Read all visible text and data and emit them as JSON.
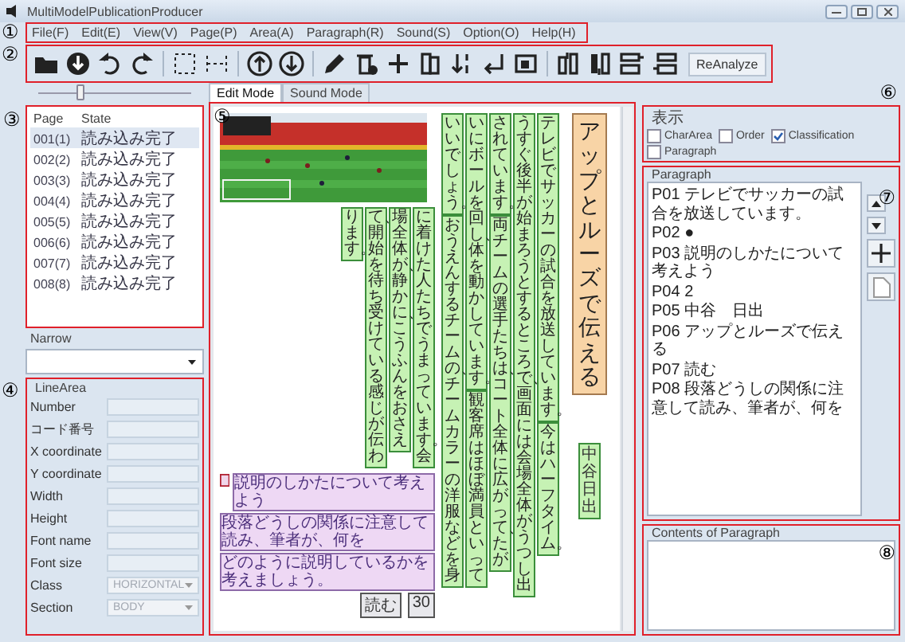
{
  "window": {
    "title": "MultiModelPublicationProducer"
  },
  "annotations": [
    "①",
    "②",
    "③",
    "④",
    "⑤",
    "⑥",
    "⑦",
    "⑧"
  ],
  "menu": [
    "File(F)",
    "Edit(E)",
    "View(V)",
    "Page(P)",
    "Area(A)",
    "Paragraph(R)",
    "Sound(S)",
    "Option(O)",
    "Help(H)"
  ],
  "toolbar": {
    "reanalyze": "ReAnalyze"
  },
  "left": {
    "page_slider": {
      "level": 0.25
    },
    "page_list": {
      "columns": [
        "Page",
        "State"
      ],
      "rows": [
        {
          "page": "001(1)",
          "state": "読み込み完了",
          "selected": true
        },
        {
          "page": "002(2)",
          "state": "読み込み完了",
          "selected": false
        },
        {
          "page": "003(3)",
          "state": "読み込み完了",
          "selected": false
        },
        {
          "page": "004(4)",
          "state": "読み込み完了",
          "selected": false
        },
        {
          "page": "005(5)",
          "state": "読み込み完了",
          "selected": false
        },
        {
          "page": "006(6)",
          "state": "読み込み完了",
          "selected": false
        },
        {
          "page": "007(7)",
          "state": "読み込み完了",
          "selected": false
        },
        {
          "page": "008(8)",
          "state": "読み込み完了",
          "selected": false
        }
      ]
    },
    "narrow": {
      "label": "Narrow"
    },
    "line_area": {
      "title": "LineArea",
      "fields": [
        {
          "label": "Number",
          "kind": "text"
        },
        {
          "label": "コード番号",
          "kind": "text"
        },
        {
          "label": "X coordinate",
          "kind": "text"
        },
        {
          "label": "Y coordinate",
          "kind": "text"
        },
        {
          "label": "Width",
          "kind": "text"
        },
        {
          "label": "Height",
          "kind": "text"
        },
        {
          "label": "Font name",
          "kind": "text"
        },
        {
          "label": "Font size",
          "kind": "text"
        },
        {
          "label": "Class",
          "kind": "select",
          "value": "HORIZONTAL",
          "disabled": true
        },
        {
          "label": "Section",
          "kind": "select",
          "value": "BODY",
          "disabled": true
        }
      ]
    }
  },
  "tabs": [
    {
      "label": "Edit Mode",
      "selected": true
    },
    {
      "label": "Sound Mode",
      "selected": false
    }
  ],
  "document": {
    "title": "アップとルーズで伝える",
    "author": "中谷日出",
    "top_columns": [
      {
        "segments": [
          "いいでしょう。",
          "おうえんするチームの、チームカラーの洋服などを身"
        ]
      },
      {
        "segments": [
          "いにボールを回し、体を動かしています。",
          "観客席はほぼ満員といって"
        ]
      },
      {
        "segments": [
          "されています。",
          "両チームの選手たちは、コート全体に広がって、たが"
        ]
      },
      {
        "segments": [
          "うすぐ後半が始まろうとするところで、画面には会場全体がうつし出"
        ]
      },
      {
        "segments": [
          "テレビでサッカーの試合を放送しています。",
          "今はハーフタイム。"
        ]
      }
    ],
    "bottom_columns": [
      {
        "segments": [
          "ります。"
        ]
      },
      {
        "segments": [
          "て、開始を待ち受けている感じが伝わ"
        ]
      },
      {
        "segments": [
          "場全体が、静かに、こうふんをおさえ"
        ]
      },
      {
        "segments": [
          "に着けた人たちでうまっています。会"
        ]
      }
    ],
    "heading": "説明のしかたについて考えよう",
    "lines": [
      "段落どうしの関係に注意して読み、筆者が、何を",
      "どのように説明しているかを考えましょう。"
    ],
    "tag": "読む",
    "page_number": "30"
  },
  "right": {
    "display": {
      "title": "表示",
      "options": [
        {
          "label": "CharArea",
          "checked": false
        },
        {
          "label": "Order",
          "checked": false
        },
        {
          "label": "Classification",
          "checked": true
        },
        {
          "label": "Paragraph",
          "checked": false
        }
      ]
    },
    "paragraph": {
      "title": "Paragraph",
      "items": [
        "P01 テレビでサッカーの試合を放送しています。",
        "P02 ●",
        "P03 説明のしかたについて考えよう",
        "P04 2",
        "P05 中谷　日出",
        "P06 アップとルーズで伝える",
        "P07 読む",
        "P08 段落どうしの関係に注意して読み、筆者が、何を"
      ]
    },
    "contents": {
      "title": "Contents of Paragraph"
    }
  }
}
